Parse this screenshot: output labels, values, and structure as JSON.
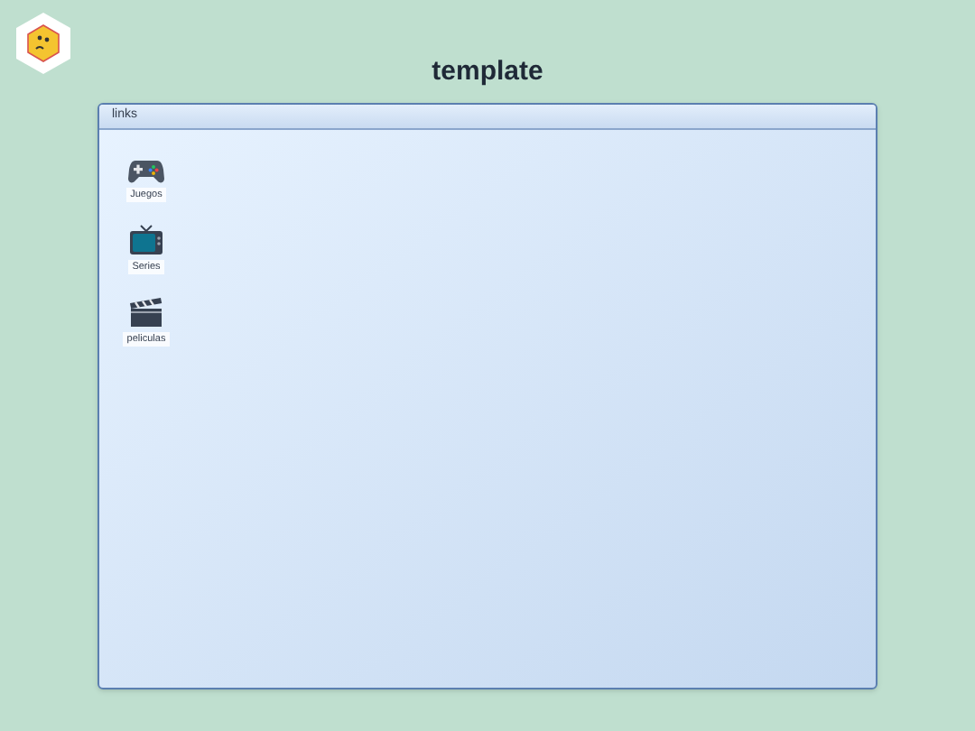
{
  "page": {
    "title": "template"
  },
  "window": {
    "title": "links"
  },
  "shortcuts": [
    {
      "kind": "gamepad",
      "label": "Juegos"
    },
    {
      "kind": "tv",
      "label": "Series"
    },
    {
      "kind": "clapper",
      "label": "peliculas"
    }
  ]
}
